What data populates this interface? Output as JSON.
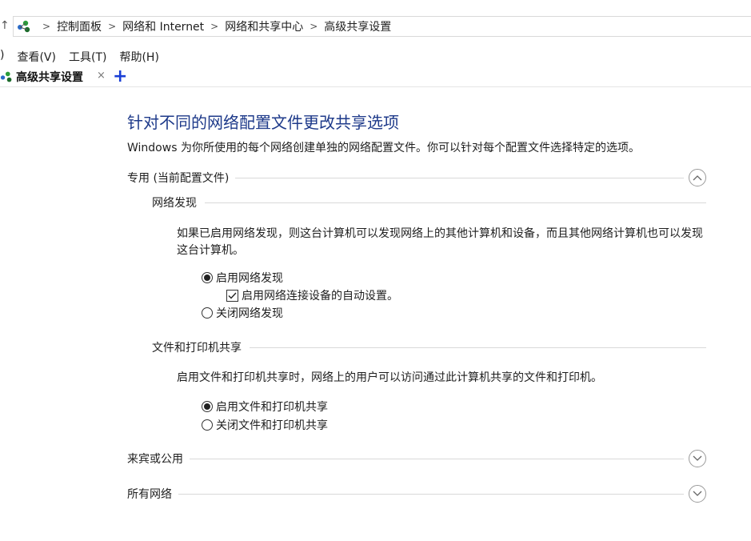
{
  "address": {
    "breadcrumbs": [
      "控制面板",
      "网络和 Internet",
      "网络和共享中心",
      "高级共享设置"
    ]
  },
  "menu": {
    "view": "查看(V)",
    "tools": "工具(T)",
    "help": "帮助(H)"
  },
  "tab": {
    "label": "高级共享设置",
    "close": "×",
    "add": "+"
  },
  "content": {
    "title": "针对不同的网络配置文件更改共享选项",
    "description": "Windows 为你所使用的每个网络创建单独的网络配置文件。你可以针对每个配置文件选择特定的选项。",
    "private": {
      "label": "专用 (当前配置文件)",
      "expanded": true,
      "discovery": {
        "heading": "网络发现",
        "text": "如果已启用网络发现，则这台计算机可以发现网络上的其他计算机和设备，而且其他网络计算机也可以发现这台计算机。",
        "opt_on": "启用网络发现",
        "opt_auto": "启用网络连接设备的自动设置。",
        "opt_off": "关闭网络发现",
        "selected": "on",
        "auto_checked": true
      },
      "sharing": {
        "heading": "文件和打印机共享",
        "text": "启用文件和打印机共享时，网络上的用户可以访问通过此计算机共享的文件和打印机。",
        "opt_on": "启用文件和打印机共享",
        "opt_off": "关闭文件和打印机共享",
        "selected": "on"
      }
    },
    "guest": {
      "label": "来宾或公用",
      "expanded": false
    },
    "all": {
      "label": "所有网络",
      "expanded": false
    }
  }
}
